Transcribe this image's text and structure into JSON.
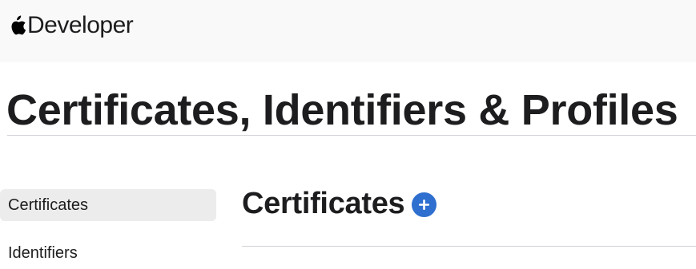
{
  "header": {
    "brand_icon": "apple-logo-icon",
    "brand_label": "Developer"
  },
  "page": {
    "title": "Certificates, Identifiers & Profiles"
  },
  "sidebar": {
    "items": [
      {
        "label": "Certificates",
        "active": true
      },
      {
        "label": "Identifiers",
        "active": false
      }
    ]
  },
  "main": {
    "section_title": "Certificates",
    "add_icon": "plus-circle-icon"
  },
  "colors": {
    "topbar_bg": "#f9f9f9",
    "active_item_bg": "#ececec",
    "accent": "#2f6fcf",
    "text": "#1d1d1f",
    "divider": "#d2d2d7"
  }
}
